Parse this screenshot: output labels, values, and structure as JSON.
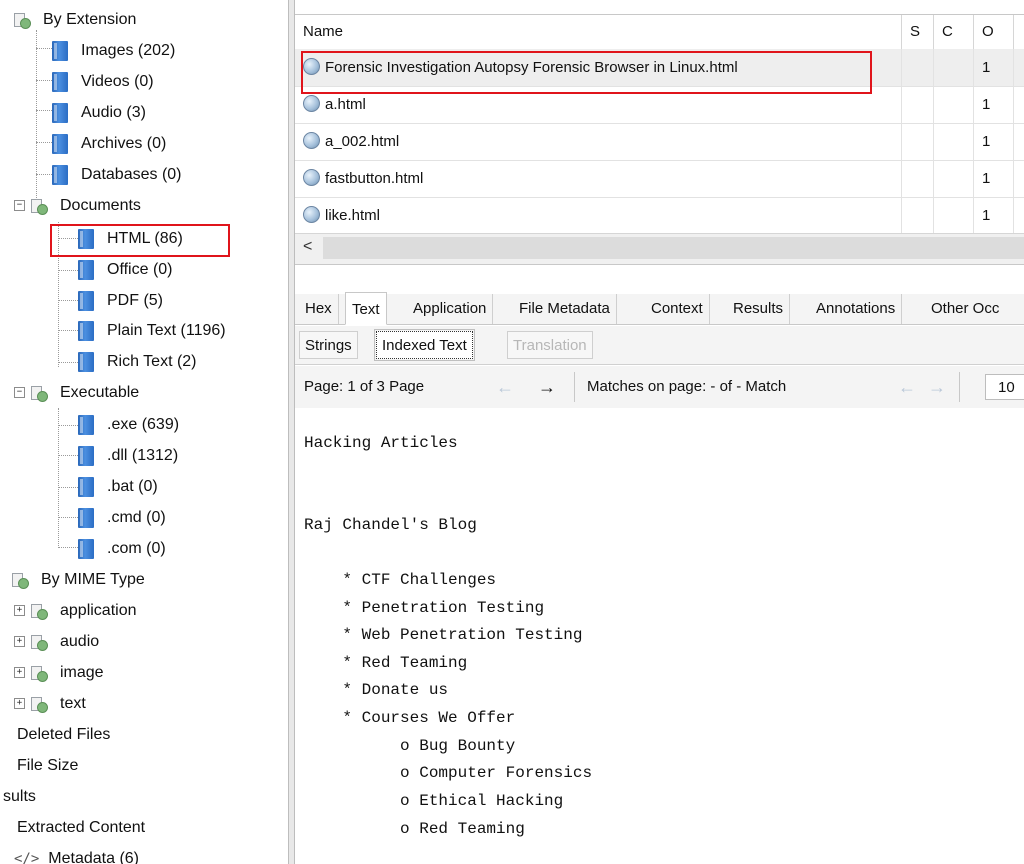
{
  "tree": {
    "by_extension": "By Extension",
    "items": [
      {
        "label": "Images (202)"
      },
      {
        "label": "Videos (0)"
      },
      {
        "label": "Audio (3)"
      },
      {
        "label": "Archives (0)"
      },
      {
        "label": "Databases (0)"
      }
    ],
    "documents": "Documents",
    "document_items": [
      {
        "label": "HTML (86)"
      },
      {
        "label": "Office (0)"
      },
      {
        "label": "PDF (5)"
      },
      {
        "label": "Plain Text (1196)"
      },
      {
        "label": "Rich Text (2)"
      }
    ],
    "executable": "Executable",
    "executable_items": [
      {
        "label": ".exe (639)"
      },
      {
        "label": ".dll (1312)"
      },
      {
        "label": ".bat (0)"
      },
      {
        "label": ".cmd (0)"
      },
      {
        "label": ".com (0)"
      }
    ],
    "by_mime": "By MIME Type",
    "mime_items": [
      {
        "label": "application"
      },
      {
        "label": "audio"
      },
      {
        "label": "image"
      },
      {
        "label": "text"
      }
    ],
    "deleted_files": "Deleted Files",
    "file_size": "File Size",
    "results": "sults",
    "extracted_content": "Extracted Content",
    "metadata": "Metadata (6)"
  },
  "table": {
    "columns": [
      "Name",
      "S",
      "C",
      "O"
    ],
    "rows": [
      {
        "name": "Forensic Investigation Autopsy Forensic Browser in Linux.html",
        "o": "1"
      },
      {
        "name": "a.html",
        "o": "1"
      },
      {
        "name": "a_002.html",
        "o": "1"
      },
      {
        "name": "fastbutton.html",
        "o": "1"
      },
      {
        "name": "like.html",
        "o": "1"
      }
    ],
    "scroll_left": "<"
  },
  "tabs": [
    "Hex",
    "Text",
    "Application",
    "File Metadata",
    "Context",
    "Results",
    "Annotations",
    "Other Occ"
  ],
  "subtabs": [
    "Strings",
    "Indexed Text",
    "Translation"
  ],
  "toolbar": {
    "page_label": "Page: 1 of 3 Page",
    "matches_label": "Matches on page:  -  of  -  Match",
    "zoom_value": "10"
  },
  "content_lines": [
    "Hacking Articles",
    "Raj Chandel's Blog",
    "    * CTF Challenges",
    "    * Penetration Testing",
    "    * Web Penetration Testing",
    "    * Red Teaming",
    "    * Donate us",
    "    * Courses We Offer",
    "          o Bug Bounty",
    "          o Computer Forensics",
    "          o Ethical Hacking",
    "          o Red Teaming"
  ],
  "colors": {
    "highlight": "#e0141b",
    "selected_row": "#eeeeee"
  }
}
